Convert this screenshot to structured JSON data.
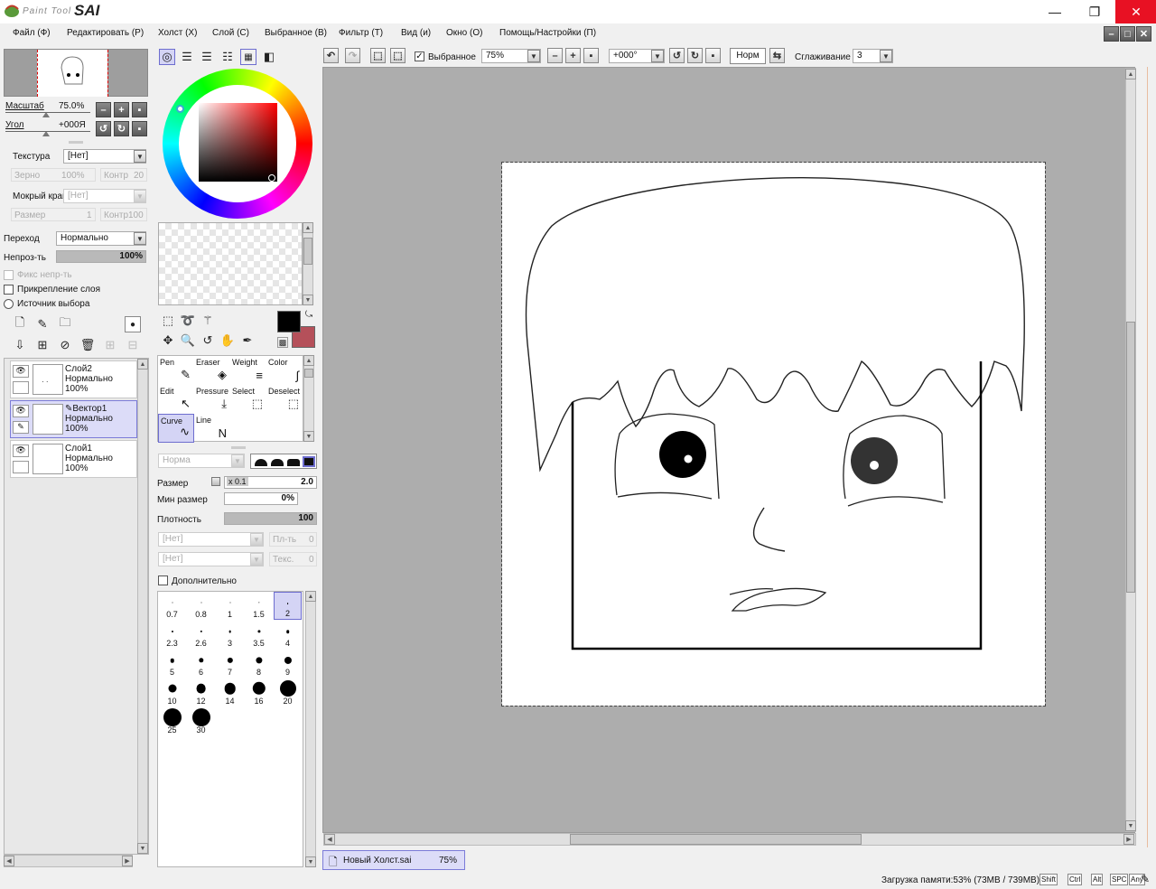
{
  "app": {
    "logo_text": "Paint Tool",
    "logo_brand": "SAI",
    "controls": {
      "minimize": "—",
      "maximize": "❐",
      "close": "✕"
    }
  },
  "menu": [
    "Файл (Ф)",
    "Редактировать (Р)",
    "Холст (Х)",
    "Слой (С)",
    "Выбранное (В)",
    "Фильтр (Т)",
    "Вид (и)",
    "Окно (О)",
    "Помощь/Настройки (П)"
  ],
  "navigator": {
    "zoom_label": "Масштаб",
    "zoom_value": "75.0%",
    "angle_label": "Угол",
    "angle_value": "+000Я"
  },
  "texture": {
    "texture_label": "Текстура",
    "texture_value": "[Нет]",
    "grain_label": "Зерно",
    "grain_value": "100%",
    "contrast_label": "Контр",
    "contrast_value": "20",
    "wet_label": "Мокрый край",
    "wet_value": "[Нет]",
    "size_label": "Размер",
    "size_value": "1",
    "contrast2_label": "Контр",
    "contrast2_value": "100"
  },
  "blend": {
    "mode_label": "Переход",
    "mode_value": "Нормально",
    "opacity_label": "Непроз-ть",
    "opacity_value": "100%",
    "opacity_fraction": 1.0,
    "fix_opacity": "Фикс непр-ть",
    "clip_layer": "Прикрепление слоя",
    "selection_source": "Источник выбора"
  },
  "layers": [
    {
      "name": "Слой2",
      "mode": "Нормально",
      "opacity": "100%",
      "selected": false,
      "vector": false
    },
    {
      "name": "Вектор1",
      "mode": "Нормально",
      "opacity": "100%",
      "selected": true,
      "vector": true
    },
    {
      "name": "Слой1",
      "mode": "Нормально",
      "opacity": "100%",
      "selected": false,
      "vector": false
    }
  ],
  "colors": {
    "primary": "#000000",
    "secondary": "#b5505a"
  },
  "tools": [
    {
      "name": "Pen",
      "icon": "pen-icon",
      "glyph": "✎"
    },
    {
      "name": "Eraser",
      "icon": "eraser-icon",
      "glyph": "◈"
    },
    {
      "name": "Weight",
      "icon": "weight-icon",
      "glyph": "≡"
    },
    {
      "name": "Color",
      "icon": "color-icon",
      "glyph": "∫"
    },
    {
      "name": "Edit",
      "icon": "edit-icon",
      "glyph": "↖"
    },
    {
      "name": "Pressure",
      "icon": "pressure-icon",
      "glyph": "⤓"
    },
    {
      "name": "Select",
      "icon": "select-icon",
      "glyph": "⬚"
    },
    {
      "name": "Deselect",
      "icon": "deselect-icon",
      "glyph": "⬚"
    },
    {
      "name": "Curve",
      "icon": "curve-icon",
      "glyph": "∿",
      "active": true
    },
    {
      "name": "Line",
      "icon": "line-icon",
      "glyph": "N"
    }
  ],
  "brush": {
    "mode_value": "Норма",
    "size_label": "Размер",
    "size_mult": "x 0.1",
    "size_value": "2.0",
    "min_size_label": "Мин размер",
    "min_size_value": "0%",
    "density_label": "Плотность",
    "density_value": "100",
    "density_fraction": 1.0,
    "tex1_value": "[Нет]",
    "tex1_label": "Пл-ть",
    "tex1_num": "0",
    "tex2_value": "[Нет]",
    "tex2_label": "Текс.",
    "tex2_num": "0",
    "advanced_label": "Дополнительно",
    "sizes": [
      "0.7",
      "0.8",
      "1",
      "1.5",
      "2",
      "2.3",
      "2.6",
      "3",
      "3.5",
      "4",
      "5",
      "6",
      "7",
      "8",
      "9",
      "10",
      "12",
      "14",
      "16",
      "20",
      "25",
      "30"
    ],
    "active_size": "2"
  },
  "toolbar": {
    "selection_label": "Выбранное",
    "zoom_value": "75%",
    "angle_value": "+000°",
    "mode_button": "Норм",
    "smoothing_label": "Сглаживание",
    "smoothing_value": "3"
  },
  "document_tab": {
    "name": "Новый Холст.sai",
    "zoom": "75%"
  },
  "status": {
    "memory": "Загрузка памяти:53% (73MB / 739MB)",
    "keys": [
      "Shift",
      "Ctrl",
      "Alt",
      "SPC",
      "Any"
    ]
  }
}
